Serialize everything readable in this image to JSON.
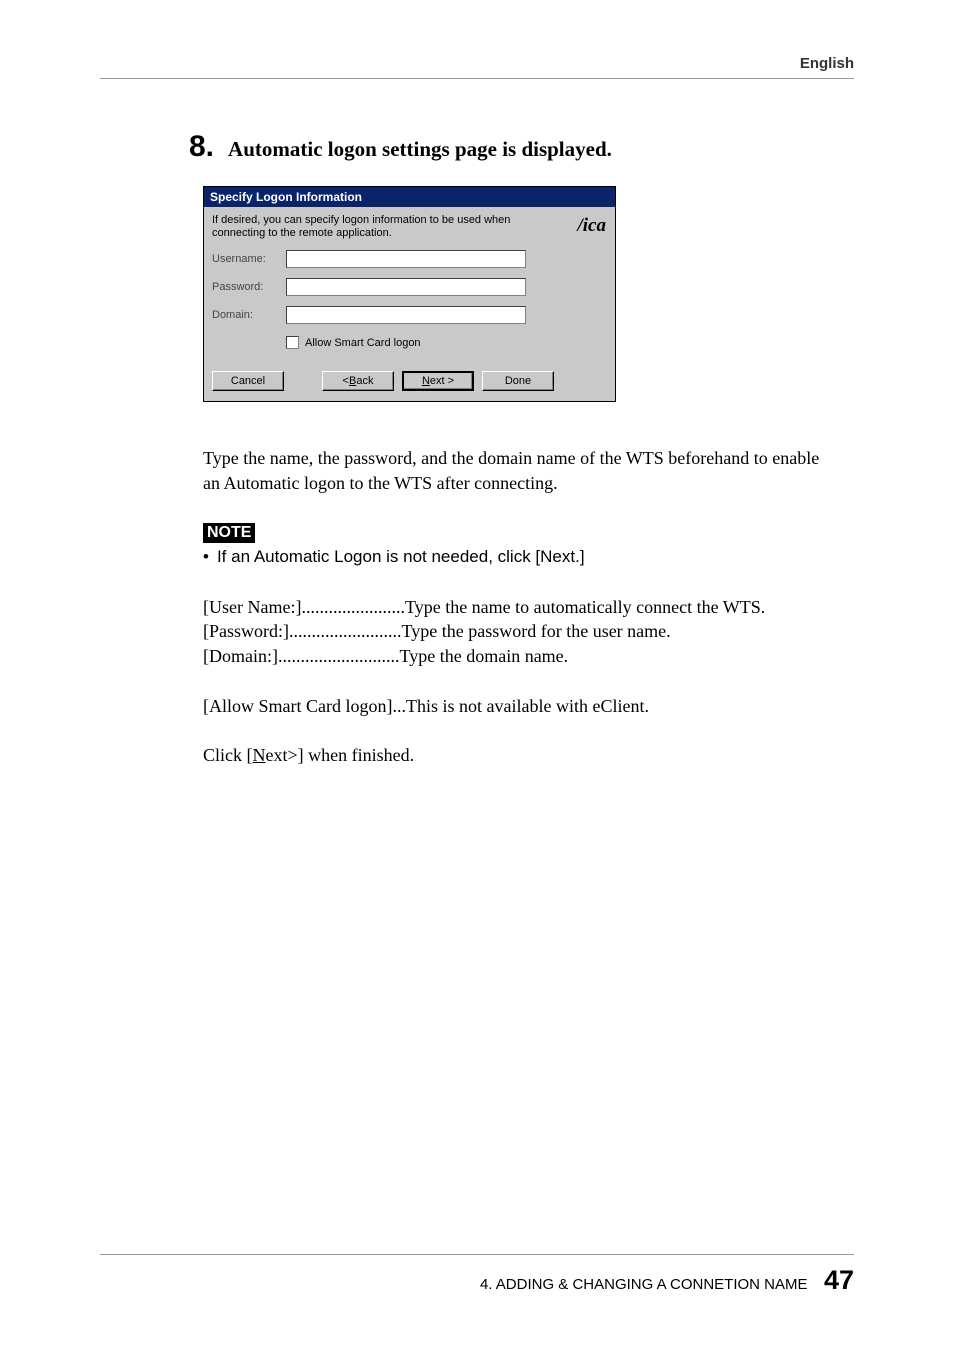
{
  "header": {
    "language": "English"
  },
  "step": {
    "number": "8.",
    "title": "Automatic logon settings page is displayed."
  },
  "dialog": {
    "title": "Specify Logon Information",
    "description": "If desired, you can specify logon information to be used when connecting to the remote application.",
    "logo": "ica",
    "fields": {
      "username_label": "Username:",
      "password_label": "Password:",
      "domain_label": "Domain:",
      "checkbox_label": "Allow Smart Card logon"
    },
    "buttons": {
      "cancel": "Cancel",
      "back_prefix": "< ",
      "back_u": "B",
      "back_rest": "ack",
      "next_u": "N",
      "next_rest": "ext >",
      "done": "Done"
    }
  },
  "paragraphs": {
    "p1": "Type the name, the password, and the domain name of the WTS beforehand to enable an Automatic logon to the WTS after connecting."
  },
  "note": {
    "label": "NOTE",
    "bullet_marker": "•",
    "bullet": "If an Automatic Logon is not needed, click [Next.]"
  },
  "defs": {
    "user_label": "[User Name:]",
    "user_dots": ".......................",
    "user_desc": "Type the name to automatically connect the WTS.",
    "pass_label": "[Password:]",
    "pass_dots": ".........................",
    "pass_desc": "Type the password for the user name.",
    "domain_label": "[Domain:]",
    "domain_dots": "...........................",
    "domain_desc": "Type the domain name."
  },
  "smart_card": {
    "label": "[Allow Smart Card logon]",
    "dots": "...",
    "desc": "This is not available with eClient."
  },
  "click_next": {
    "before": "Click [",
    "u": "N",
    "after": "ext>] when finished."
  },
  "footer": {
    "chapter": "4. ADDING & CHANGING A CONNETION NAME",
    "page": "47"
  }
}
